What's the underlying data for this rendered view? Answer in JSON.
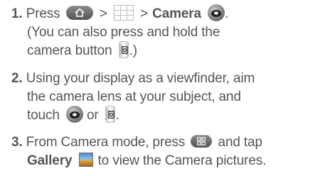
{
  "steps": [
    {
      "number": "1.",
      "line1": {
        "press": "Press",
        "gt1": ">",
        "gt2": ">",
        "camera": "Camera",
        "end": "."
      },
      "line2": "(You can also press and hold the",
      "line3": {
        "text": "camera button",
        "end": ".)"
      }
    },
    {
      "number": "2.",
      "line1": "Using your display as a viewfinder, aim",
      "line2": "the camera lens at your subject, and",
      "line3": {
        "touch": "touch",
        "or": "or",
        "end": "."
      }
    },
    {
      "number": "3.",
      "line1": {
        "text": "From Camera mode, press",
        "and_tap": "and tap"
      },
      "line2": {
        "gallery": "Gallery",
        "text": "to view the Camera pictures."
      }
    }
  ],
  "icons": {
    "home_key": "home-key-icon",
    "apps_grid": "apps-grid-icon",
    "camera_app": "camera-app-icon",
    "camera_button": "camera-side-button-icon",
    "menu_key": "menu-key-icon",
    "gallery": "gallery-icon"
  },
  "colors": {
    "text": "#555555",
    "key_gray": "#6a6a6a"
  }
}
